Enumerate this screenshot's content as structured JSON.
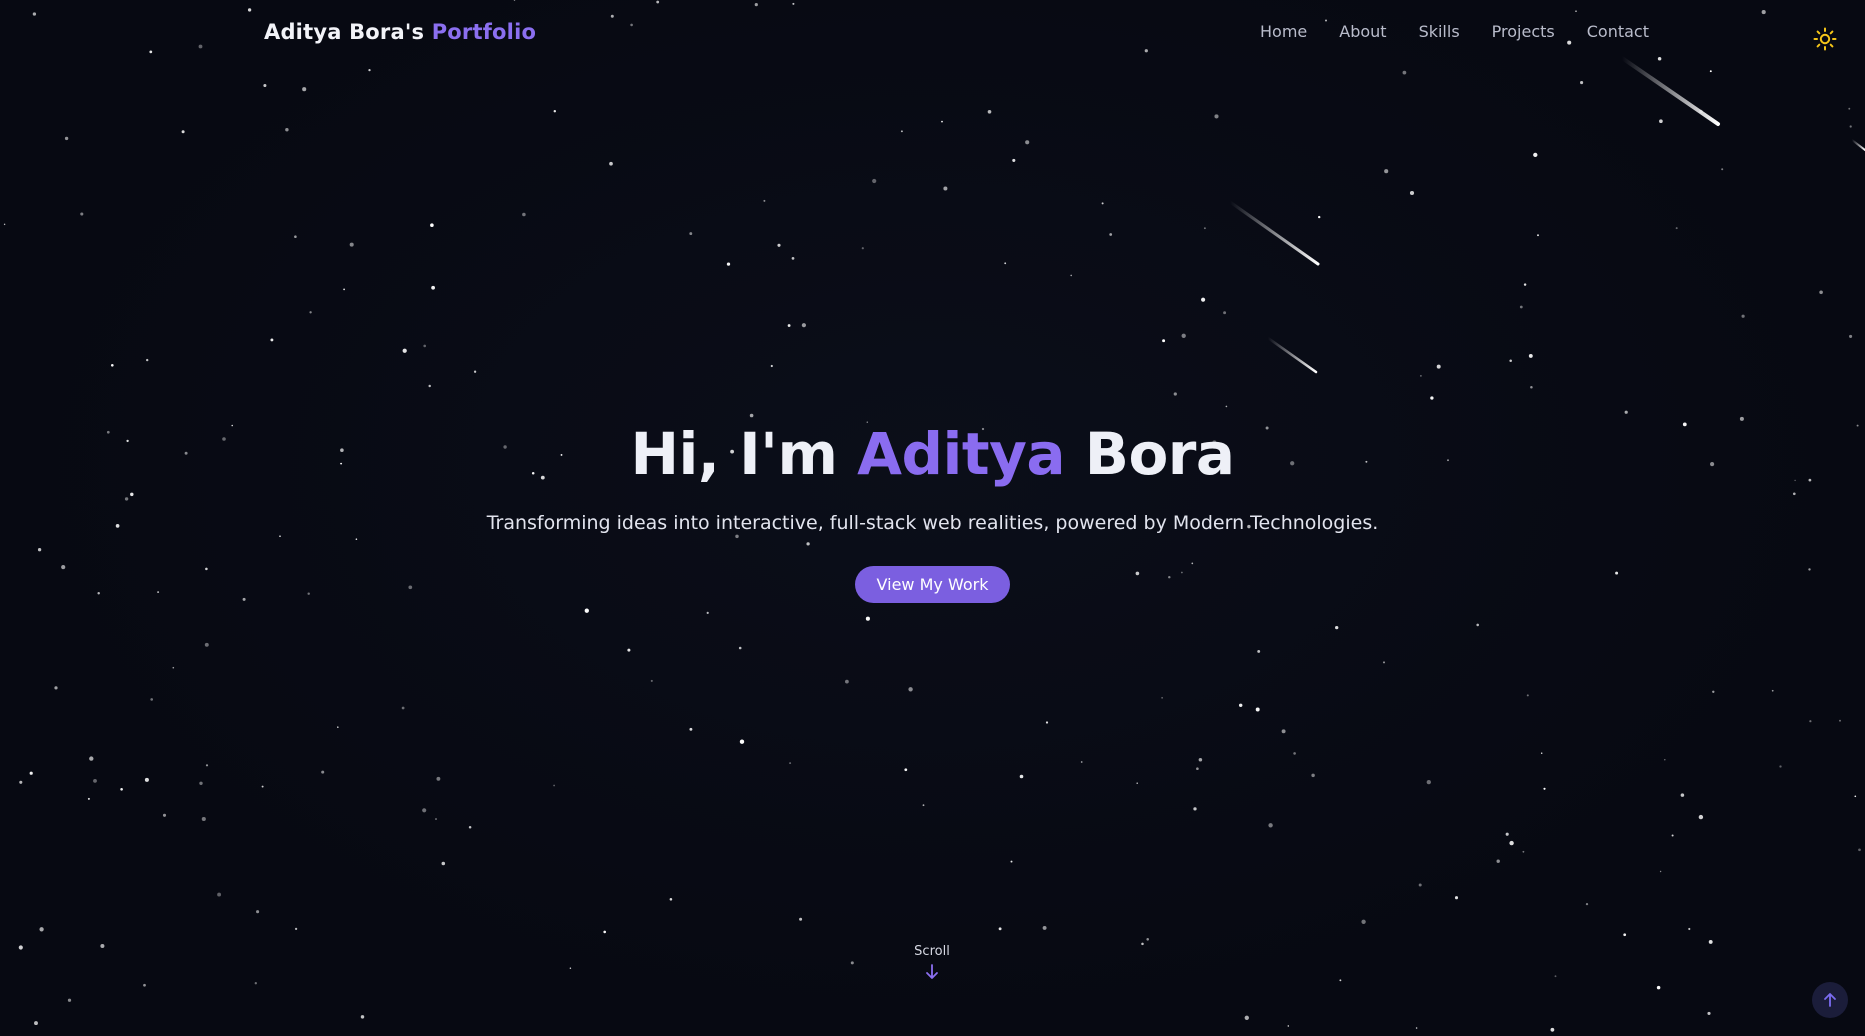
{
  "brand": {
    "name": "Aditya Bora's",
    "accent": "Portfolio"
  },
  "nav": {
    "items": [
      "Home",
      "About",
      "Skills",
      "Projects",
      "Contact"
    ]
  },
  "theme_toggle": {
    "icon": "sun-icon"
  },
  "hero": {
    "greeting": "Hi, I'm",
    "first_name": "Aditya",
    "last_name": "Bora",
    "subtitle": "Transforming ideas into interactive, full-stack web realities, powered by Modern Technologies.",
    "cta_label": "View My Work"
  },
  "scroll": {
    "label": "Scroll",
    "icon": "arrow-down-icon"
  },
  "back_to_top": {
    "icon": "arrow-up-icon"
  },
  "colors": {
    "background": "#070912",
    "accent": "#8b6ff0",
    "button": "#7b5fe0",
    "sun": "#f5c518"
  }
}
